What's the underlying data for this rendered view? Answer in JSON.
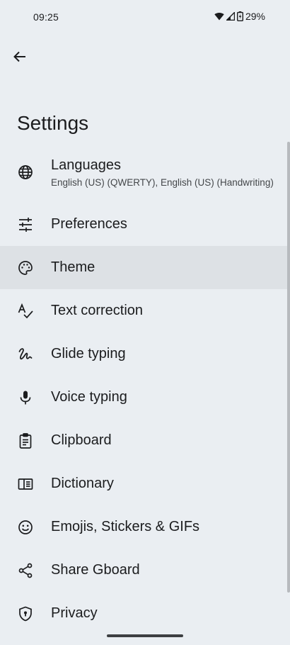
{
  "status_bar": {
    "time": "09:25",
    "battery": "29%"
  },
  "header": {
    "title": "Settings"
  },
  "settings_items": [
    {
      "label": "Languages",
      "sub": "English (US) (QWERTY), English (US) (Handwriting)",
      "icon": "globe-icon"
    },
    {
      "label": "Preferences",
      "icon": "tune-icon"
    },
    {
      "label": "Theme",
      "icon": "palette-icon",
      "selected": true
    },
    {
      "label": "Text correction",
      "icon": "spellcheck-icon"
    },
    {
      "label": "Glide typing",
      "icon": "gesture-icon"
    },
    {
      "label": "Voice typing",
      "icon": "mic-icon"
    },
    {
      "label": "Clipboard",
      "icon": "clipboard-icon"
    },
    {
      "label": "Dictionary",
      "icon": "book-icon"
    },
    {
      "label": "Emojis, Stickers & GIFs",
      "icon": "emoji-icon"
    },
    {
      "label": "Share Gboard",
      "icon": "share-icon"
    },
    {
      "label": "Privacy",
      "icon": "shield-lock-icon"
    }
  ],
  "colors": {
    "background": "#eaeef2",
    "selected_row": "#dde1e5",
    "text": "#1b1c1e"
  }
}
